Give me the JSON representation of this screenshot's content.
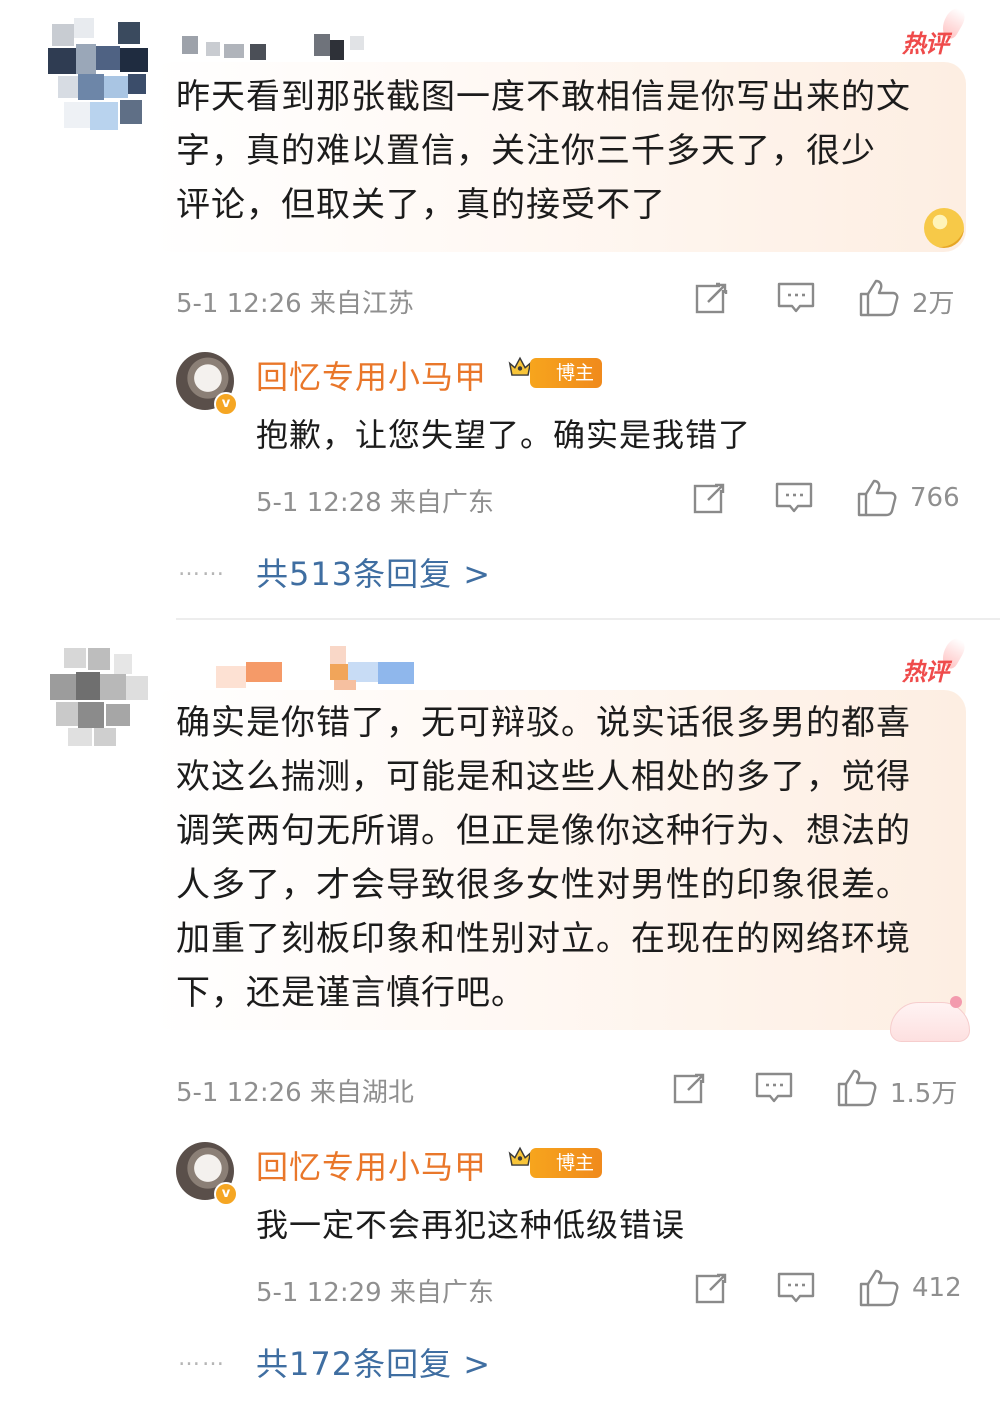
{
  "hot_badge_label": "热评",
  "comments": [
    {
      "text": "昨天看到那张截图一度不敢相信是你写出来的文字，真的难以置信，关注你三千多天了，很少评论，但取关了，真的接受不了",
      "lines": [
        "昨天看到那张截图一度不敢相信是你写出来的文",
        "字，真的难以置信，关注你三千多天了，很少",
        "评论，但取关了，真的接受不了"
      ],
      "meta": "5-1 12:26 来自江苏",
      "likes": "2万",
      "reply": {
        "author": "回忆专用小马甲",
        "badge": "博主",
        "text": "抱歉，让您失望了。确实是我错了",
        "meta": "5-1 12:28 来自广东",
        "likes": "766"
      },
      "more_replies_dots": "……",
      "more_replies": "共513条回复 >"
    },
    {
      "text": "确实是你错了，无可辩驳。说实话很多男的都喜欢这么揣测，可能是和这些人相处的多了，觉得调笑两句无所谓。但正是像你这种行为、想法的人多了，才会导致很多女性对男性的印象很差。加重了刻板印象和性别对立。在现在的网络环境下，还是谨言慎行吧。",
      "lines": [
        "确实是你错了，无可辩驳。说实话很多男的都喜",
        "欢这么揣测，可能是和这些人相处的多了，觉得",
        "调笑两句无所谓。但正是像你这种行为、想法的",
        "人多了，才会导致很多女性对男性的印象很差。",
        "加重了刻板印象和性别对立。在现在的网络环境",
        "下，还是谨言慎行吧。"
      ],
      "meta": "5-1 12:26 来自湖北",
      "likes": "1.5万",
      "reply": {
        "author": "回忆专用小马甲",
        "badge": "博主",
        "text": "我一定不会再犯这种低级错误",
        "meta": "5-1 12:29 来自广东",
        "likes": "412"
      },
      "more_replies_dots": "……",
      "more_replies": "共172条回复 >"
    }
  ]
}
